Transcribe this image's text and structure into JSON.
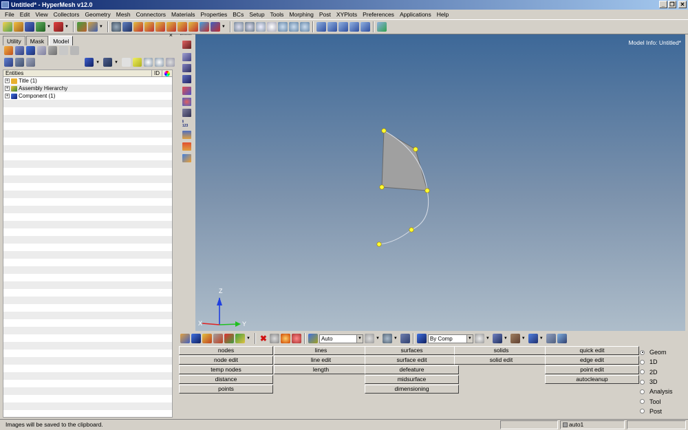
{
  "window": {
    "title": "Untitled* - HyperMesh v12.0",
    "buttons": [
      "_",
      "❐",
      "✕"
    ]
  },
  "menu": [
    "File",
    "Edit",
    "View",
    "Collectors",
    "Geometry",
    "Mesh",
    "Connectors",
    "Materials",
    "Properties",
    "BCs",
    "Setup",
    "Tools",
    "Morphing",
    "Post",
    "XYPlots",
    "Preferences",
    "Applications",
    "Help"
  ],
  "browser": {
    "tabs": [
      "Utility",
      "Mask",
      "Model"
    ],
    "active_tab": "Model",
    "close": "×",
    "columns": {
      "entities": "Entities",
      "id": "ID"
    },
    "tree": [
      {
        "label": "Title (1)",
        "icon": "title-folder-icon",
        "color": "#e8b030"
      },
      {
        "label": "Assembly Hierarchy",
        "icon": "assembly-icon",
        "color": "#3a8a3a"
      },
      {
        "label": "Component (1)",
        "icon": "component-icon",
        "color": "#2050c0"
      }
    ]
  },
  "viewport": {
    "model_info": "Model Info: Untitled*",
    "triad": {
      "z": "Z",
      "x": "X",
      "y": "Y"
    },
    "surface_color": "#a0a0a0",
    "point_color": "#ffff30"
  },
  "bottom_toolbar": {
    "auto_combo": "Auto",
    "bycomp_combo": "By Comp"
  },
  "panel": {
    "col1": [
      "nodes",
      "node edit",
      "temp nodes",
      "distance",
      "points"
    ],
    "col2": [
      "lines",
      "line edit",
      "length"
    ],
    "col3": [
      "surfaces",
      "surface edit",
      "defeature",
      "midsurface",
      "dimensioning"
    ],
    "col4": [
      "solids",
      "solid edit"
    ],
    "col5": [
      "quick edit",
      "edge edit",
      "point edit",
      "autocleanup"
    ]
  },
  "page_radios": [
    {
      "label": "Geom",
      "selected": true
    },
    {
      "label": "1D",
      "selected": false
    },
    {
      "label": "2D",
      "selected": false
    },
    {
      "label": "3D",
      "selected": false
    },
    {
      "label": "Analysis",
      "selected": false
    },
    {
      "label": "Tool",
      "selected": false
    },
    {
      "label": "Post",
      "selected": false
    }
  ],
  "status": {
    "message": "Images will be saved to the clipboard.",
    "collector": "auto1"
  }
}
